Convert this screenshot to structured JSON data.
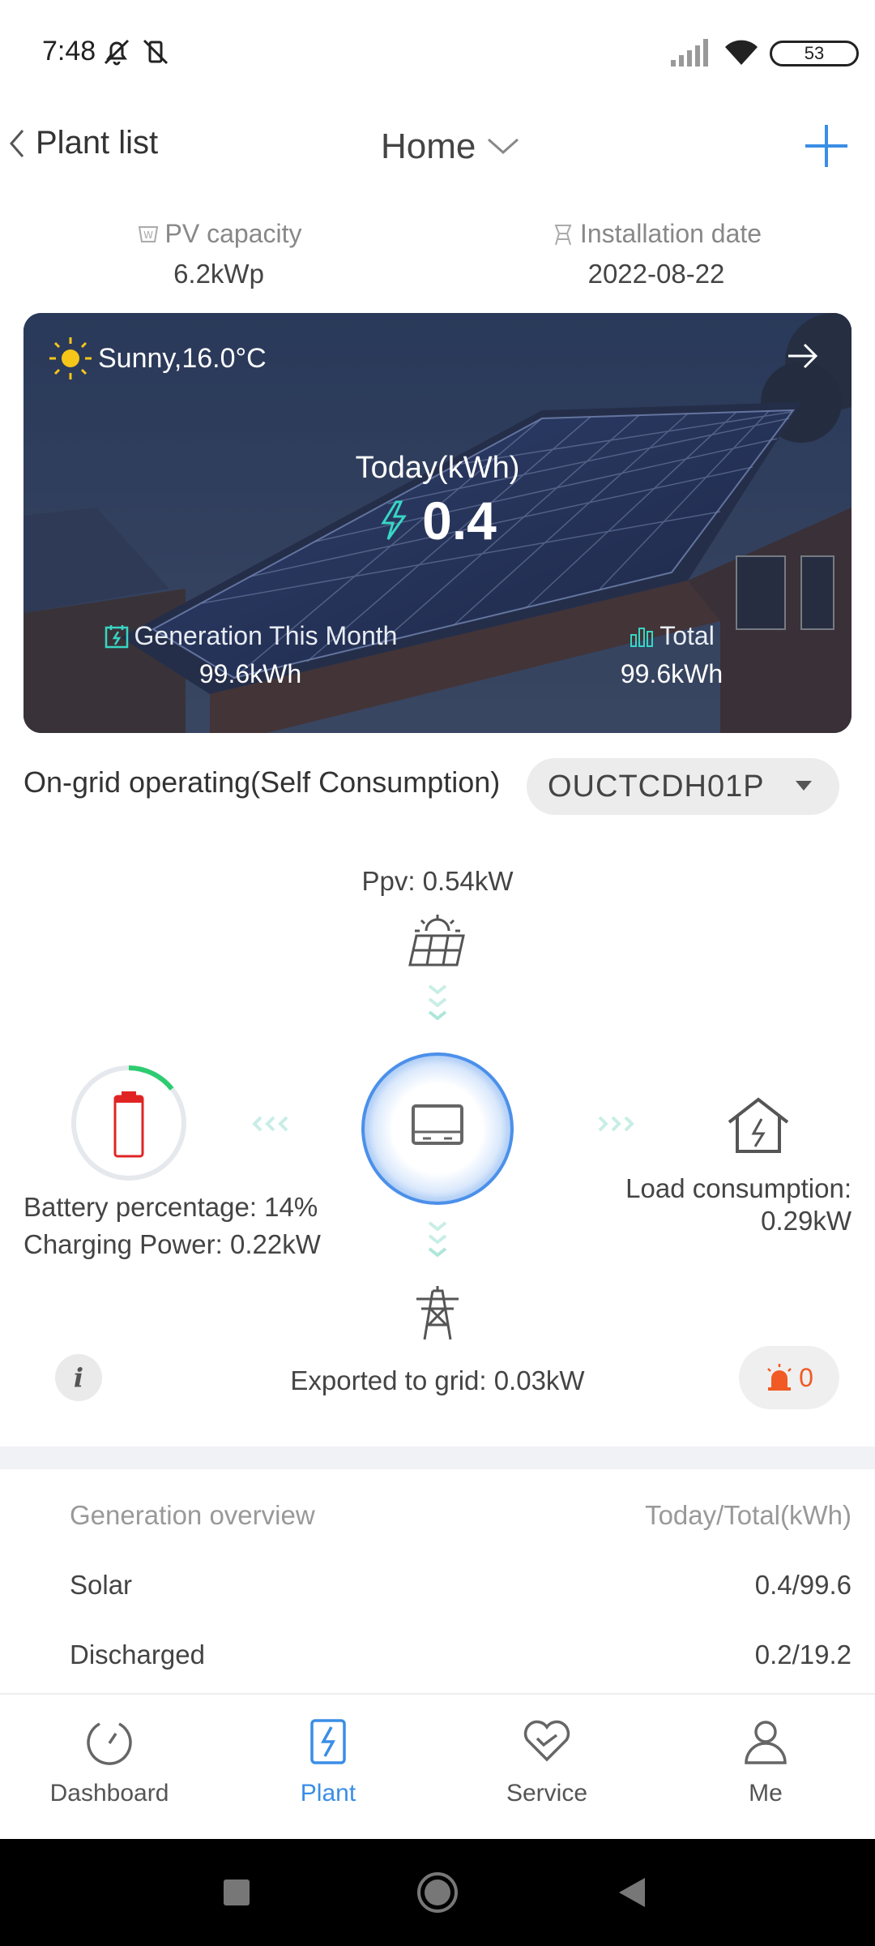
{
  "status_bar": {
    "time": "7:48",
    "battery": "53"
  },
  "header": {
    "back_label": "Plant list",
    "title": "Home",
    "accent_color": "#3a8ee6"
  },
  "plant_info": {
    "pv_capacity_label": "PV capacity",
    "pv_capacity_value": "6.2kWp",
    "install_date_label": "Installation date",
    "install_date_value": "2022-08-22"
  },
  "hero": {
    "weather": "Sunny,16.0°C",
    "today_label": "Today(kWh)",
    "today_value": "0.4",
    "month_label": "Generation This Month",
    "month_value": "99.6kWh",
    "total_label": "Total",
    "total_value": "99.6kWh"
  },
  "mode": {
    "text": "On-grid operating(Self Consumption)",
    "device": "OUCTCDH01P"
  },
  "flow": {
    "ppv": "Ppv: 0.54kW",
    "battery_percentage": "Battery percentage: 14%",
    "battery_level": 0.14,
    "charging_power": "Charging Power: 0.22kW",
    "load_line1": "Load consumption:",
    "load_line2": "0.29kW",
    "grid": "Exported to grid: 0.03kW",
    "alarm_count": "0"
  },
  "overview": {
    "title": "Generation overview",
    "unit": "Today/Total(kWh)",
    "rows": [
      {
        "label": "Solar",
        "value": "0.4/99.6"
      },
      {
        "label": "Discharged",
        "value": "0.2/19.2"
      }
    ]
  },
  "nav": {
    "items": [
      {
        "label": "Dashboard"
      },
      {
        "label": "Plant"
      },
      {
        "label": "Service"
      },
      {
        "label": "Me"
      }
    ]
  }
}
